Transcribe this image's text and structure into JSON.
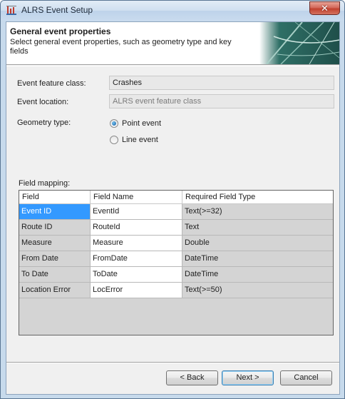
{
  "window": {
    "title": "ALRS Event Setup",
    "close_label": "✕"
  },
  "header": {
    "title": "General event properties",
    "description": "Select general event properties, such as geometry type and key fields"
  },
  "form": {
    "feature_class_label": "Event feature class:",
    "feature_class_value": "Crashes",
    "location_label": "Event location:",
    "location_value": "ALRS event feature class",
    "geometry_label": "Geometry type:",
    "geometry_options": [
      {
        "label": "Point event",
        "checked": true
      },
      {
        "label": "Line event",
        "checked": false
      }
    ]
  },
  "field_mapping": {
    "label": "Field mapping:",
    "columns": [
      "Field",
      "Field Name",
      "Required Field Type"
    ],
    "rows": [
      {
        "field": "Event ID",
        "field_name": "EventId",
        "type": "Text(>=32)",
        "selected": true
      },
      {
        "field": "Route ID",
        "field_name": "RouteId",
        "type": "Text"
      },
      {
        "field": "Measure",
        "field_name": "Measure",
        "type": "Double"
      },
      {
        "field": "From Date",
        "field_name": "FromDate",
        "type": "DateTime"
      },
      {
        "field": "To Date",
        "field_name": "ToDate",
        "type": "DateTime"
      },
      {
        "field": "Location Error",
        "field_name": "LocError",
        "type": "Text(>=50)"
      }
    ]
  },
  "buttons": {
    "back": "< Back",
    "next": "Next >",
    "cancel": "Cancel"
  }
}
